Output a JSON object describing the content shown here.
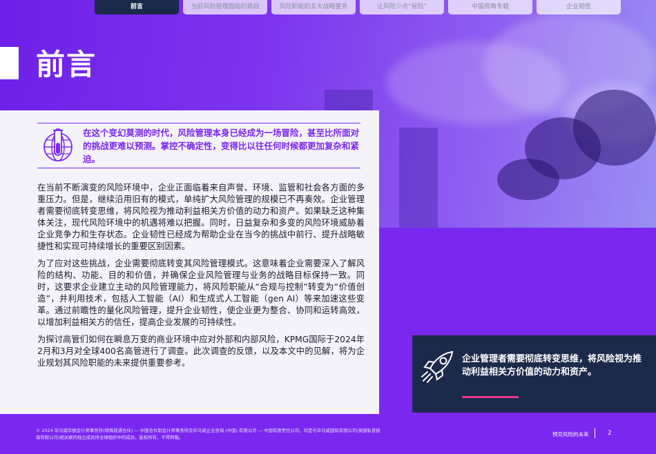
{
  "nav": {
    "tabs": [
      {
        "label": "前言",
        "active": true
      },
      {
        "label": "当前风险管理面临的挑战",
        "active": false
      },
      {
        "label": "风险职能的五大战略要务",
        "active": false
      },
      {
        "label": "让风险少点“冒险”",
        "active": false
      },
      {
        "label": "中国视角专题",
        "active": false
      },
      {
        "label": "企业韧性",
        "active": false
      }
    ]
  },
  "page": {
    "title": "前言"
  },
  "quote": {
    "text": "在这个变幻莫测的时代，风险管理本身已经成为一场冒险，甚至比所面对的挑战更难以预测。掌控不确定性，变得比以往任何时候都更加复杂和紧迫。",
    "icon": "globe-flask-icon"
  },
  "body": {
    "paragraphs": [
      "在当前不断演变的风险环境中，企业正面临着来自声誉、环境、监管和社会各方面的多重压力。但是，继续沿用旧有的模式，单纯扩大风险管理的规模已不再奏效。企业管理者需要彻底转变思维，将风险视为推动利益相关方价值的动力和资产。如果缺乏这种集体关注，现代风险环境中的机遇将难以把握。同时，日益复杂和多变的风险环境威胁着企业竞争力和生存状态。企业韧性已经成为帮助企业在当今的挑战中前行、提升战略敏捷性和实现可持续增长的重要区别因素。",
      "为了应对这些挑战，企业需要彻底转变其风险管理模式。这意味着企业需要深入了解风险的结构、功能、目的和价值，并确保企业风险管理与业务的战略目标保持一致。同时，这要求企业建立主动的风险管理能力，将风险职能从“合规与控制”转变为“价值创造”，并利用技术，包括人工智能（AI）和生成式人工智能（gen AI）等来加速这些变革。通过前瞻性的量化风险管理，提升企业韧性，使企业更为整合、协同和运转高效，以增加利益相关方的信任，提高企业发展的可持续性。",
      "为探讨高管们如何在瞬息万变的商业环境中应对外部和内部风险，KPMG国际于2024年2月和3月对全球400名高管进行了调查。此次调查的反馈，以及本文中的见解，将为企业规划其风险职能的未来提供重要参考。"
    ]
  },
  "callout": {
    "text": "企业管理者需要彻底转变思维，将风险视为推动利益相关方价值的动力和资产。",
    "icon": "rocket-icon"
  },
  "footer": {
    "legal": "© 2024 毕马威华振会计师事务所(特殊普通合伙) — 中国合伙制会计师事务所及毕马威企业咨询 (中国) 有限公司 — 中国有限责任公司，均是与毕马威国际有限公司(英国私营担保有限公司)相关联的独立成员所全球组织中的成员。版权所有，不得转载。",
    "report_name": "预见风险的未来",
    "page_number": "2"
  },
  "colors": {
    "brand_purple": "#7a28f0",
    "navy": "#1b2a4a",
    "accent_pink": "#e6398c"
  }
}
